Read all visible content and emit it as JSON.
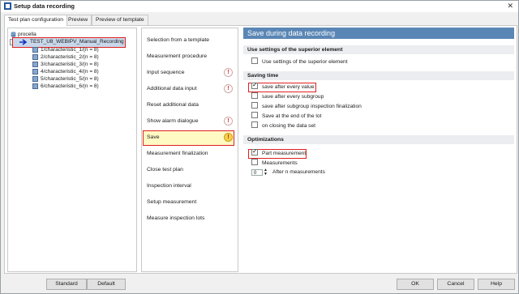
{
  "window": {
    "title": "Setup data recording"
  },
  "tabs": [
    {
      "label": "Test plan configuration"
    },
    {
      "label": "Preview"
    },
    {
      "label": "Preview of template"
    }
  ],
  "tree": {
    "root": "procella",
    "test_plan": "TEST_U8_WEBIPV_Manual_Recording",
    "children": [
      "1/characteristic_1/(n = 8)",
      "2/characteristic_2/(n = 8)",
      "3/characteristic_3/(n = 8)",
      "4/characteristic_4/(n = 8)",
      "5/characteristic_5/(n = 8)",
      "6/characteristic_6/(n = 8)"
    ]
  },
  "steps": [
    {
      "label": "Selection from a template",
      "warning": false
    },
    {
      "label": "Measurement procedure",
      "warning": false
    },
    {
      "label": "Input sequence",
      "warning": true
    },
    {
      "label": "Additional data input",
      "warning": true
    },
    {
      "label": "Reset additional data",
      "warning": false
    },
    {
      "label": "Show alarm dialogue",
      "warning": true
    },
    {
      "label": "Save",
      "warning": true,
      "selected": true
    },
    {
      "label": "Measurement finalization",
      "warning": false
    },
    {
      "label": "Close test plan",
      "warning": false
    },
    {
      "label": "Inspection interval",
      "warning": false
    },
    {
      "label": "Setup measurement",
      "warning": false
    },
    {
      "label": "Measure inspection lots",
      "warning": false
    }
  ],
  "warning_symbol": "!",
  "panel": {
    "title": "Save during data recording",
    "superior": {
      "heading": "Use settings of the superior element",
      "option": {
        "label": "Use settings of the superior element",
        "checked": false
      }
    },
    "saving_time": {
      "heading": "Saving time",
      "options": [
        {
          "label": "save after every value",
          "checked": true
        },
        {
          "label": "save after every subgroup",
          "checked": false
        },
        {
          "label": "save after subgroup inspection finalization",
          "checked": false
        },
        {
          "label": "Save at the end of the lot",
          "checked": false
        },
        {
          "label": "on closing the data set",
          "checked": false
        }
      ]
    },
    "optimizations": {
      "heading": "Optimizations",
      "options": [
        {
          "label": "Part measurement",
          "checked": true
        },
        {
          "label": "Measurements",
          "checked": false
        }
      ],
      "n_value": "0",
      "n_label": "After n measurements"
    }
  },
  "buttons": {
    "standard": "Standard",
    "default": "Default",
    "ok": "OK",
    "cancel": "Cancel",
    "help": "Help"
  },
  "colors": {
    "header": "#5a86b5",
    "highlight": "#e02020",
    "selected_step": "#fff9c4",
    "tree_selected": "#c8d8ea"
  }
}
